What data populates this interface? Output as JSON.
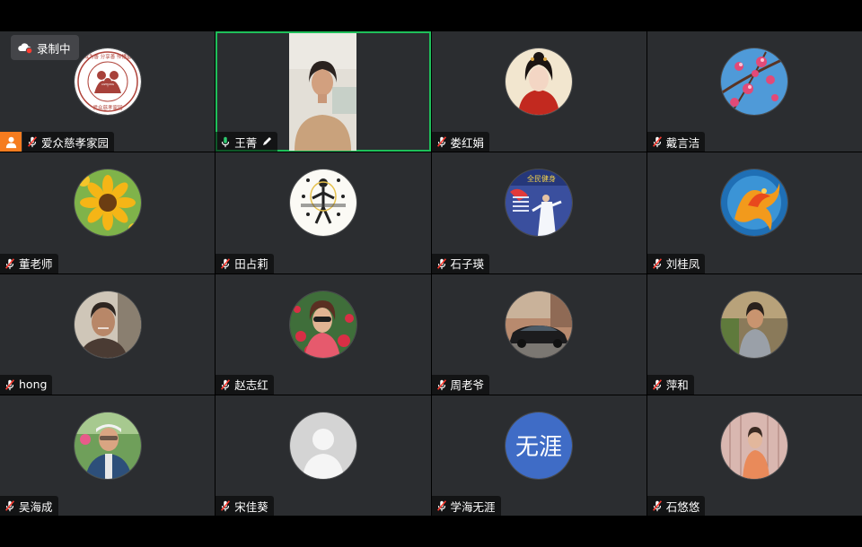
{
  "recording": {
    "label": "录制中"
  },
  "colors": {
    "active_border": "#1fbf5a",
    "host_badge": "#f57c1f",
    "muted_mic": "#ff3b30",
    "active_mic": "#2ecc71"
  },
  "participants": [
    {
      "name": "爱众慈孝家园",
      "mic": "muted",
      "host": true,
      "avatar": "logo-badge-avatar",
      "badge": {
        "top": "成为善 分享善 传播善",
        "bottom": "爱众慈孝家园",
        "center": "AIZHONG"
      }
    },
    {
      "name": "王菁",
      "mic": "active",
      "speaking": true,
      "avatar": "camera-video"
    },
    {
      "name": "娄红娟",
      "mic": "muted",
      "avatar": "costume-portrait-avatar"
    },
    {
      "name": "戴言洁",
      "mic": "muted",
      "avatar": "blossom-avatar"
    },
    {
      "name": "董老师",
      "mic": "muted",
      "avatar": "sunflower-avatar"
    },
    {
      "name": "田占莉",
      "mic": "muted",
      "avatar": "taiji-figure-avatar"
    },
    {
      "name": "石子瑛",
      "mic": "muted",
      "avatar": "taichi-banner-avatar",
      "banner": "全民健身"
    },
    {
      "name": "刘桂凤",
      "mic": "muted",
      "avatar": "phoenix-avatar"
    },
    {
      "name": "hong",
      "mic": "muted",
      "avatar": "man-photo-avatar"
    },
    {
      "name": "赵志红",
      "mic": "muted",
      "avatar": "woman-flowers-avatar"
    },
    {
      "name": "周老爷",
      "mic": "muted",
      "avatar": "car-avatar"
    },
    {
      "name": "萍和",
      "mic": "muted",
      "avatar": "woman-outdoor-avatar"
    },
    {
      "name": "吴海成",
      "mic": "muted",
      "avatar": "elder-man-avatar"
    },
    {
      "name": "宋佳葵",
      "mic": "muted",
      "avatar": "default-person-avatar"
    },
    {
      "name": "学海无涯",
      "mic": "muted",
      "avatar": "text-avatar",
      "avatar_text": "无涯"
    },
    {
      "name": "石悠悠",
      "mic": "muted",
      "avatar": "child-photo-avatar"
    }
  ]
}
